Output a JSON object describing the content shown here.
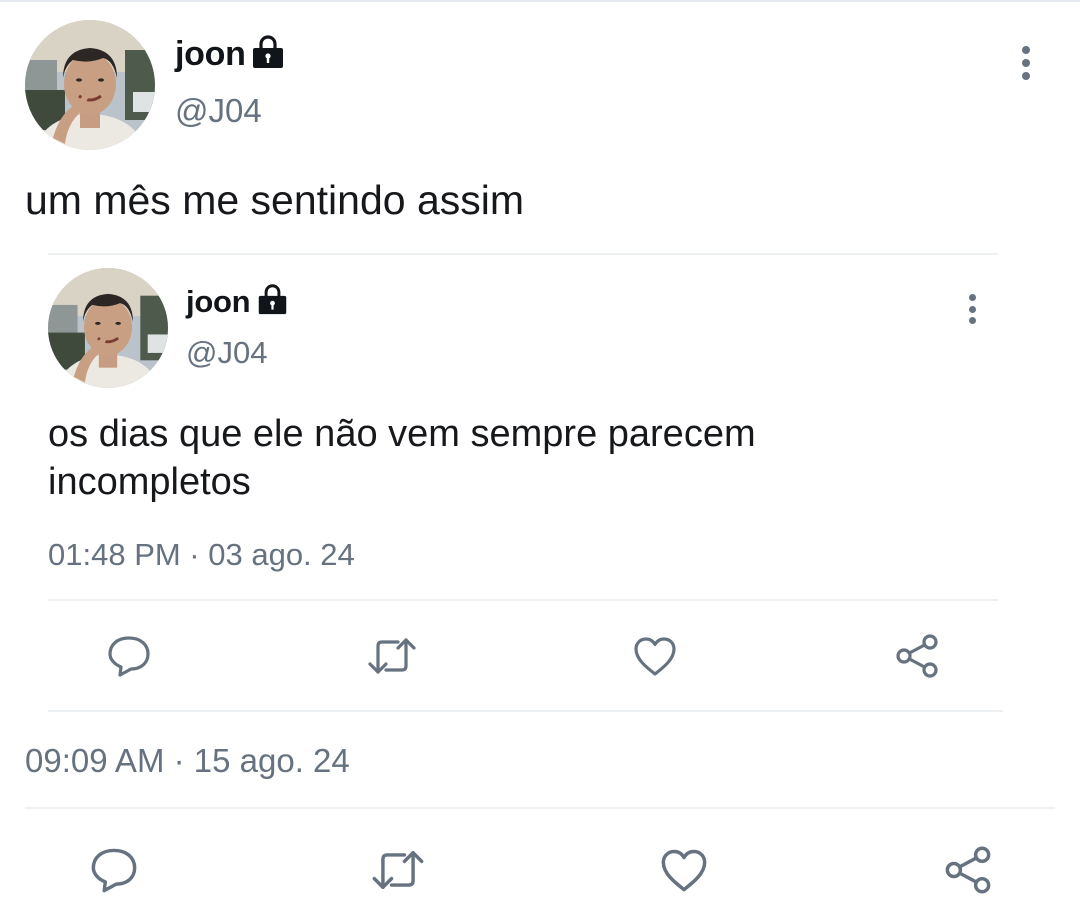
{
  "tweet": {
    "author_name": "joon",
    "author_handle": "@J04",
    "text": "um mês me sentindo assim",
    "timestamp": "09:09 AM · 15 ago. 24",
    "icons": {
      "locked": "lock-icon",
      "more": "more-vertical-icon",
      "reply": "reply-icon",
      "retweet": "retweet-icon",
      "like": "heart-icon",
      "share": "share-icon"
    }
  },
  "quoted": {
    "author_name": "joon",
    "author_handle": "@J04",
    "text": "os dias que ele não vem sempre parecem incompletos",
    "timestamp": "01:48 PM · 03 ago. 24"
  },
  "colors": {
    "text": "#16181c",
    "secondary": "#66727f",
    "divider": "#edf0f3",
    "background": "#ffffff"
  }
}
